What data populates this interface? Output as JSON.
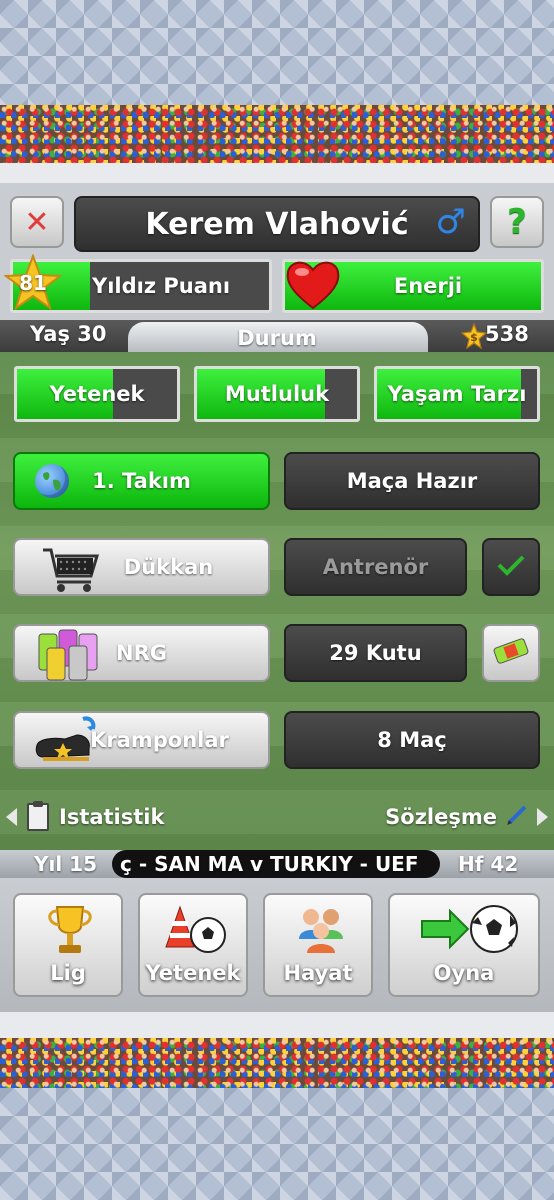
{
  "header": {
    "player_name": "Kerem Vlahović",
    "gender_symbol": "♂",
    "close_symbol": "✕",
    "help_symbol": "?"
  },
  "stats": {
    "star_points_value": "81",
    "star_points_label": "Yıldız Puanı",
    "star_points_fill": 0.3,
    "energy_label": "Enerji",
    "energy_fill": 1.0
  },
  "status_strip": {
    "age": "Yaş 30",
    "title": "Durum",
    "money": "538"
  },
  "attributes": [
    {
      "label": "Yetenek",
      "fill": 0.6
    },
    {
      "label": "Mutluluk",
      "fill": 0.8
    },
    {
      "label": "Yaşam Tarzı",
      "fill": 0.9
    }
  ],
  "rows": {
    "team": {
      "label": "1. Takım",
      "status": "Maça Hazır"
    },
    "shop": {
      "label": "Dükkan",
      "status": "Antrenör"
    },
    "nrg": {
      "label": "NRG",
      "status": "29 Kutu"
    },
    "boots": {
      "label": "Kramponlar",
      "status": "8 Maç"
    }
  },
  "nav": {
    "left_label": "Istatistik",
    "right_label": "Sözleşme"
  },
  "ticker": {
    "year": "Yıl 15",
    "news": "ç - SAN MA v TURKIY - UEF",
    "week": "Hf 42"
  },
  "bottom_buttons": [
    {
      "label": "Lig"
    },
    {
      "label": "Yetenek"
    },
    {
      "label": "Hayat"
    },
    {
      "label": "Oyna"
    }
  ],
  "colors": {
    "accent_green": "#13c313",
    "dark_button": "#3a3a3a",
    "close_red": "#e03a3a",
    "help_green": "#2db52d",
    "heart_red": "#e21a1a"
  }
}
